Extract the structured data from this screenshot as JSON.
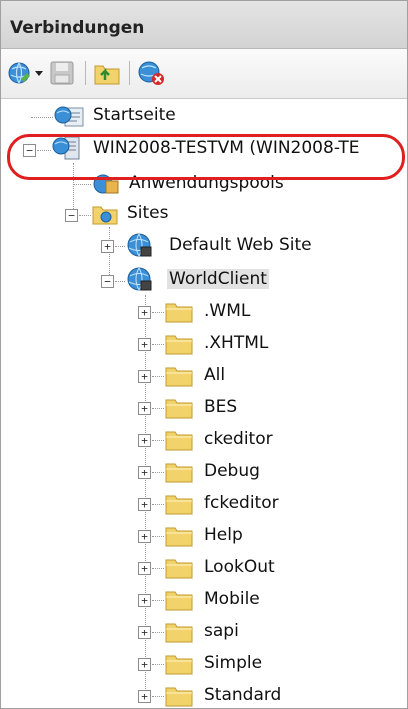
{
  "panel": {
    "title": "Verbindungen"
  },
  "toolbar": {
    "icons": [
      "globe-connect-icon",
      "save-icon",
      "folder-up-icon",
      "globe-disconnect-icon"
    ]
  },
  "tree": {
    "startseite": "Startseite",
    "server": "WIN2008-TESTVM (WIN2008-TE",
    "apppools": "Anwendungspools",
    "sites": "Sites",
    "default_site": "Default Web Site",
    "worldclient": "WorldClient",
    "folders": [
      ".WML",
      ".XHTML",
      "All",
      "BES",
      "ckeditor",
      "Debug",
      "fckeditor",
      "Help",
      "LookOut",
      "Mobile",
      "sapi",
      "Simple",
      "Standard"
    ]
  },
  "colors": {
    "highlight": "#e02020",
    "folder": "#f2d36b",
    "selection": "#e2e2e2"
  }
}
